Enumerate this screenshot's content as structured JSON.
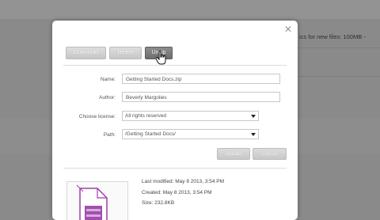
{
  "background": {
    "text": "ics for new files: 100MB -"
  },
  "dialog": {
    "close_glyph": "✕",
    "toolbar": {
      "download_label": "Download",
      "delete_label": "Delete",
      "unzip_label": "Unzip"
    },
    "form": {
      "name_label": "Name:",
      "name_value": "Getting Started Docs.zip",
      "author_label": "Author:",
      "author_value": "Beverly Margolies",
      "license_label": "Choose license:",
      "license_value": "All rights reserved",
      "path_label": "Path:",
      "path_value": "/Getting Started Docs/"
    },
    "actions": {
      "update_label": "Update",
      "cancel_label": "Cancel"
    },
    "file_info": {
      "last_modified": "Last modified: May 8 2013, 3:54 PM",
      "created": "Created: May 8 2013, 3:54 PM",
      "size": "Size: 232.8KB"
    },
    "colors": {
      "active_button": "#7a7a7a",
      "file_icon_accent": "#9b3fa8"
    },
    "icons": [
      "close-icon",
      "pointer-hand-icon",
      "dropdown-arrow-icon",
      "archive-file-icon"
    ]
  }
}
